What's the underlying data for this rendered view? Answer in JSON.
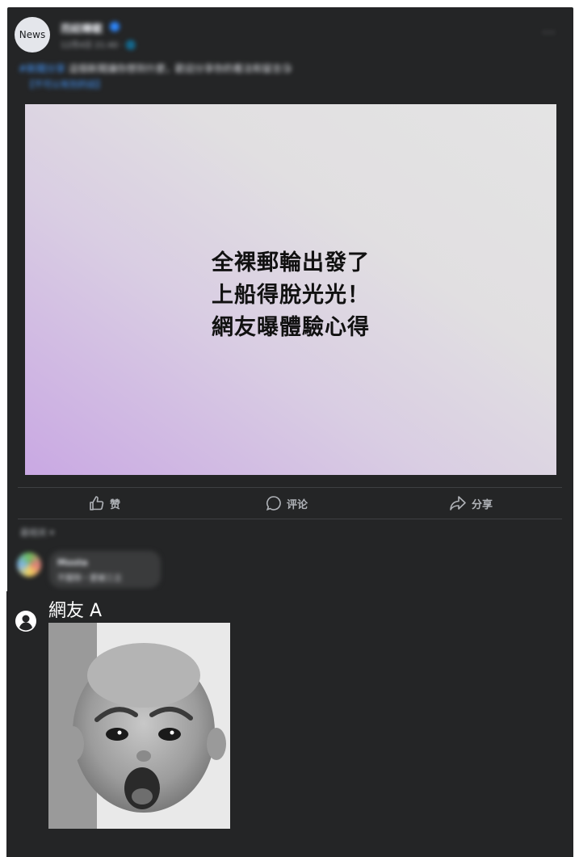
{
  "post": {
    "avatar_label": "News",
    "page_name": "而紐轉載",
    "time": "12月4日 21:40 · 🌐",
    "text_tag": "#新聞分享",
    "text": "這個新聞讓你想到什麼，歡迎分享你的看法和留言😘",
    "link": "【不可以有別的話】",
    "more": "···",
    "headline": {
      "line1": "全裸郵輪出發了",
      "line2": "上船得脫光光！",
      "line3": "網友曝體驗心得"
    },
    "actions": {
      "like": "赞",
      "comment": "评论",
      "share": "分享"
    },
    "sort": "最相关 ▾",
    "comment": {
      "name": "Mosta",
      "body": "不服除・愛被三立"
    }
  },
  "reply": {
    "name": "網友 A"
  },
  "colors": {
    "card_bg": "#242526",
    "text_primary": "#e4e6eb",
    "text_secondary": "#b0b3b8",
    "link": "#4599ff"
  },
  "icons": {
    "like": "thumbs-up-icon",
    "comment": "speech-bubble-icon",
    "share": "share-arrow-icon",
    "user": "user-circle-icon",
    "verified": "verified-badge-icon",
    "more": "more-options-icon"
  }
}
